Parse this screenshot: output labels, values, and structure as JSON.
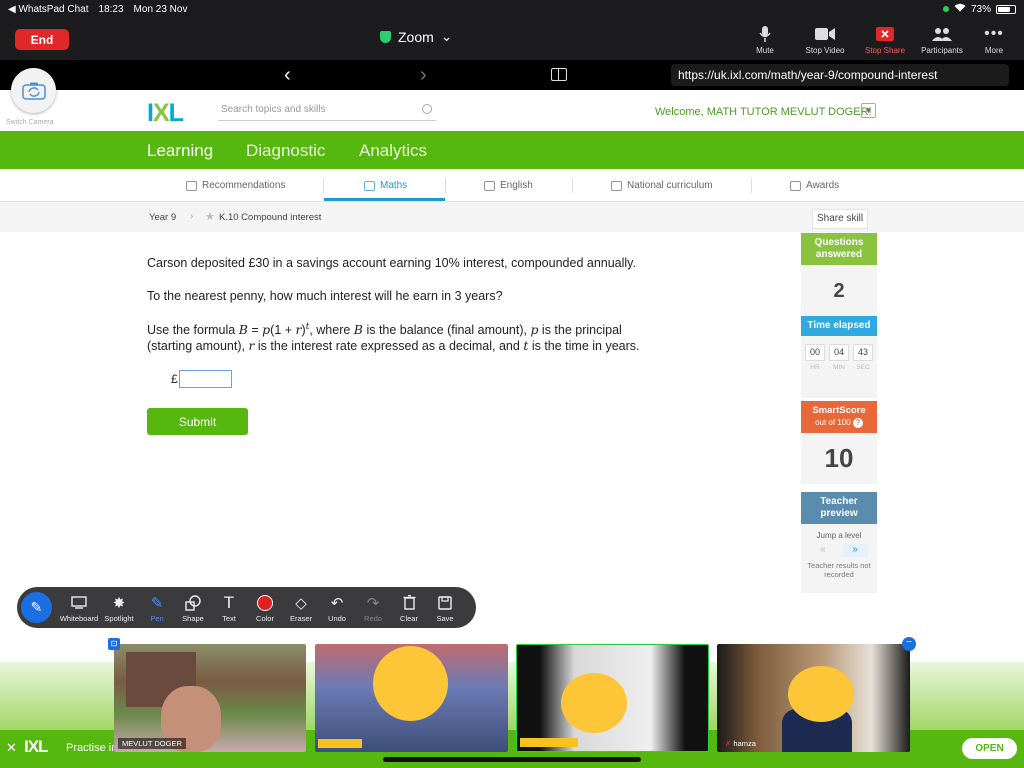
{
  "statusbar": {
    "back_app": "◀ WhatsPad Chat",
    "time": "18:23",
    "date": "Mon 23 Nov",
    "battery": "73%",
    "battery_level": 0.73
  },
  "zoom": {
    "end_label": "End",
    "title": "Zoom",
    "controls": {
      "mute": "Mute",
      "stop_video": "Stop Video",
      "stop_share": "Stop Share",
      "participants": "Participants",
      "more": "More"
    }
  },
  "browser": {
    "url": "https://uk.ixl.com/math/year-9/compound-interest"
  },
  "camera": {
    "label": "Switch Camera"
  },
  "ixl": {
    "logo_i": "I",
    "logo_x": "X",
    "logo_l": "L",
    "search_placeholder": "Search topics and skills",
    "welcome": "Welcome, MATH TUTOR MEVLUT DOGER!",
    "main_nav": [
      "Learning",
      "Diagnostic",
      "Analytics"
    ],
    "subject_tabs": [
      "Recommendations",
      "Maths",
      "English",
      "National curriculum",
      "Awards"
    ],
    "breadcrumb": {
      "year": "Year 9",
      "skill": "K.10 Compound interest"
    },
    "share_skill": "Share skill"
  },
  "question": {
    "line1": "Carson deposited £30 in a savings account earning 10% interest, compounded annually.",
    "line2": "To the nearest penny, how much interest will he earn in 3 years?",
    "formula_intro": "Use the formula ",
    "formula_B": "B",
    "formula_eq": " = ",
    "formula_p": "p",
    "formula_mid": "(1 + ",
    "formula_r": "r",
    "formula_close": ")",
    "formula_t": "t",
    "formula_after1": ", where ",
    "formula_B2": "B",
    "formula_after2": " is the balance (final amount), ",
    "formula_p2": "p",
    "formula_after3": " is the principal",
    "line4_start": "(starting amount), ",
    "line4_r": "r",
    "line4_mid": " is the interest rate expressed as a decimal, and ",
    "line4_t": "t",
    "line4_end": " is the time in years.",
    "currency": "£",
    "answer_value": "",
    "submit_label": "Submit"
  },
  "stats": {
    "questions_answered_label": "Questions answered",
    "questions_answered": "2",
    "time_elapsed_label": "Time elapsed",
    "time_hr": "00",
    "time_min": "04",
    "time_sec": "43",
    "hr_label": "HR",
    "min_label": "MIN",
    "sec_label": "SEC",
    "smartscore_label": "SmartScore",
    "smartscore_sub": "out of 100",
    "smartscore_help": "?",
    "smartscore": "10",
    "teacher_preview_label": "Teacher preview",
    "jump_level": "Jump a level",
    "jump_back": "«",
    "jump_forward": "»",
    "teacher_results": "Teacher results not recorded"
  },
  "annotation_tools": [
    "Whiteboard",
    "Spotlight",
    "Pen",
    "Shape",
    "Text",
    "Color",
    "Eraser",
    "Undo",
    "Redo",
    "Clear",
    "Save"
  ],
  "video_tiles": [
    {
      "name": "MEVLUT DOGER"
    },
    {
      "name": ""
    },
    {
      "name": ""
    },
    {
      "name": "hamza"
    }
  ],
  "banner": {
    "close": "✕",
    "logo": "IXL",
    "text": "Practise in",
    "open_label": "OPEN"
  },
  "colors": {
    "ixl_green": "#56b80f",
    "ixl_blue": "#1c9ad6",
    "zoom_end_red": "#e02828",
    "smartscore_orange": "#e8683a"
  }
}
